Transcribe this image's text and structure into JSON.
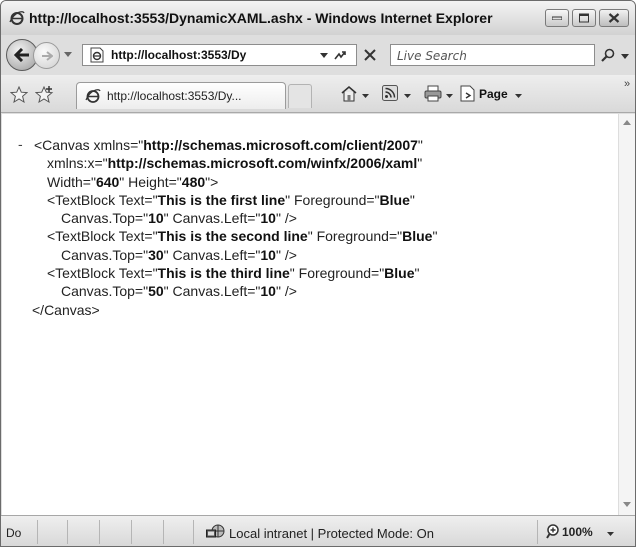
{
  "window": {
    "title": "http://localhost:3553/DynamicXAML.ashx - Windows Internet Explorer"
  },
  "address_bar": {
    "value": "http://localhost:3553/Dy"
  },
  "search": {
    "placeholder": "Live Search"
  },
  "tab": {
    "title": "http://localhost:3553/Dy..."
  },
  "command_bar": {
    "page_label": "Page"
  },
  "document": {
    "collapse_marker": "-",
    "lines": [
      {
        "pre": "<Canvas xmlns=\"",
        "v1": "http://schemas.microsoft.com/client/2007",
        "mid": "\"",
        "v2": "",
        "post": ""
      },
      {
        "pre": "xmlns:x=\"",
        "v1": "http://schemas.microsoft.com/winfx/2006/xaml",
        "mid": "\"",
        "v2": "",
        "post": ""
      },
      {
        "pre": "Width=\"",
        "v1": "640",
        "mid": "\" Height=\"",
        "v2": "480",
        "post": "\">"
      },
      {
        "pre": "<TextBlock Text=\"",
        "v1": "This is the first line",
        "mid": "\" Foreground=\"",
        "v2": "Blue",
        "post": "\""
      },
      {
        "pre": "Canvas.Top=\"",
        "v1": "10",
        "mid": "\" Canvas.Left=\"",
        "v2": "10",
        "post": "\" />"
      },
      {
        "pre": "<TextBlock Text=\"",
        "v1": "This is the second line",
        "mid": "\" Foreground=\"",
        "v2": "Blue",
        "post": "\""
      },
      {
        "pre": "Canvas.Top=\"",
        "v1": "30",
        "mid": "\" Canvas.Left=\"",
        "v2": "10",
        "post": "\" />"
      },
      {
        "pre": "<TextBlock Text=\"",
        "v1": "This is the third line",
        "mid": "\" Foreground=\"",
        "v2": "Blue",
        "post": "\""
      },
      {
        "pre": "Canvas.Top=\"",
        "v1": "50",
        "mid": "\" Canvas.Left=\"",
        "v2": "10",
        "post": "\" />"
      },
      {
        "pre": "</Canvas>",
        "v1": "",
        "mid": "",
        "v2": "",
        "post": ""
      }
    ]
  },
  "status_bar": {
    "text": "Do",
    "zone": "Local intranet | Protected Mode: On",
    "zoom": "100%"
  },
  "colors": {
    "frame": "#dedede",
    "content_bg": "#ffffff",
    "text": "#222222"
  }
}
